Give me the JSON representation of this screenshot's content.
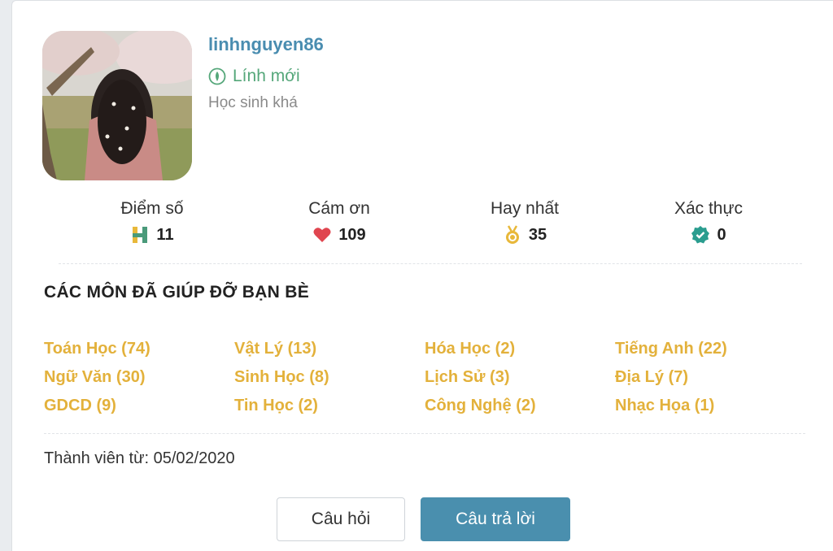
{
  "profile": {
    "username": "linhnguyen86",
    "rank": "Lính mới",
    "level": "Học sinh khá",
    "avatar_alt": "avatar"
  },
  "stats": [
    {
      "label": "Điểm số",
      "value": "11",
      "icon": "h-points-icon"
    },
    {
      "label": "Cám ơn",
      "value": "109",
      "icon": "heart-icon"
    },
    {
      "label": "Hay nhất",
      "value": "35",
      "icon": "medal-icon"
    },
    {
      "label": "Xác thực",
      "value": "0",
      "icon": "verified-check-icon"
    }
  ],
  "subjects_title": "CÁC MÔN ĐÃ GIÚP ĐỠ BẠN BÈ",
  "subjects": [
    "Toán Học (74)",
    "Vật Lý (13)",
    "Hóa Học (2)",
    "Tiếng Anh (22)",
    "Ngữ Văn (30)",
    "Sinh Học (8)",
    "Lịch Sử (3)",
    "Địa Lý (7)",
    "GDCD (9)",
    "Tin Học (2)",
    "Công Nghệ (2)",
    "Nhạc Họa (1)"
  ],
  "member_since": "Thành viên từ: 05/02/2020",
  "buttons": {
    "questions": "Câu hỏi",
    "answers": "Câu trả lời"
  },
  "colors": {
    "username": "#4a8db0",
    "rank": "#55a77a",
    "subject": "#e3b13b",
    "primary_button": "#4a8fae",
    "heart": "#e0454f",
    "verified": "#2a9d8f"
  }
}
